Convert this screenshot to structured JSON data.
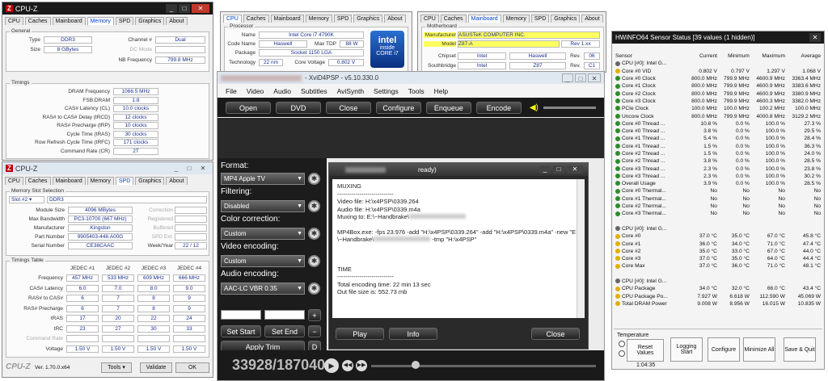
{
  "cpuz_mem": {
    "title": "CPU-Z",
    "tabs": [
      "CPU",
      "Caches",
      "Mainboard",
      "Memory",
      "SPD",
      "Graphics",
      "About"
    ],
    "active": "Memory",
    "general_label": "General",
    "type_label": "Type",
    "type": "DDR3",
    "size_label": "Size",
    "size": "8 GBytes",
    "channel_label": "Channel #",
    "channel": "Dual",
    "dcmode_label": "DC Mode",
    "nbfreq_label": "NB Frequency",
    "nbfreq": "799.8 MHz",
    "timings_label": "Timings",
    "timings": [
      {
        "l": "DRAM Frequency",
        "v": "1066.5 MHz"
      },
      {
        "l": "FSB:DRAM",
        "v": "1:8"
      },
      {
        "l": "CAS# Latency (CL)",
        "v": "10.0 clocks"
      },
      {
        "l": "RAS# to CAS# Delay (tRCD)",
        "v": "12 clocks"
      },
      {
        "l": "RAS# Precharge (tRP)",
        "v": "10 clocks"
      },
      {
        "l": "Cycle Time (tRAS)",
        "v": "30 clocks"
      },
      {
        "l": "Row Refresh Cycle Time (tRFC)",
        "v": "171 clocks"
      },
      {
        "l": "Command Rate (CR)",
        "v": "2T"
      }
    ]
  },
  "cpuz_spd": {
    "title": "CPU-Z",
    "tabs": [
      "CPU",
      "Caches",
      "Mainboard",
      "Memory",
      "SPD",
      "Graphics",
      "About"
    ],
    "active": "SPD",
    "slot_label": "Memory Slot Selection",
    "slot": "Slot #2",
    "slot_type": "DDR3",
    "rows": [
      {
        "l": "Module Size",
        "v": "4096 MBytes",
        "r": "Correction"
      },
      {
        "l": "Max Bandwidth",
        "v": "PC3-10700 (667 MHz)",
        "r": "Registered"
      },
      {
        "l": "Manufacturer",
        "v": "Kingston",
        "r": "Buffered"
      },
      {
        "l": "Part Number",
        "v": "9905403-448.A00G",
        "r": "SPD Ext."
      },
      {
        "l": "Serial Number",
        "v": "CE38CAAC",
        "r": "Week/Year",
        "rv": "22 / 12"
      }
    ],
    "tt_label": "Timings Table",
    "tt_headers": [
      "JEDEC #1",
      "JEDEC #2",
      "JEDEC #3",
      "JEDEC #4"
    ],
    "tt_rows": [
      {
        "l": "Frequency",
        "v": [
          "457 MHz",
          "533 MHz",
          "609 MHz",
          "666 MHz"
        ]
      },
      {
        "l": "CAS# Latency",
        "v": [
          "6.0",
          "7.0",
          "8.0",
          "9.0"
        ]
      },
      {
        "l": "RAS# to CAS#",
        "v": [
          "6",
          "7",
          "8",
          "9"
        ]
      },
      {
        "l": "RAS# Precharge",
        "v": [
          "6",
          "7",
          "8",
          "9"
        ]
      },
      {
        "l": "tRAS",
        "v": [
          "17",
          "20",
          "22",
          "24"
        ]
      },
      {
        "l": "tRC",
        "v": [
          "23",
          "27",
          "30",
          "33"
        ]
      },
      {
        "l": "Command Rate",
        "v": [
          "",
          "",
          "",
          ""
        ]
      },
      {
        "l": "Voltage",
        "v": [
          "1.50 V",
          "1.50 V",
          "1.50 V",
          "1.50 V"
        ]
      }
    ],
    "footer_brand": "CPU-Z",
    "version": "Ver. 1.70.0.x64",
    "tools": "Tools",
    "validate": "Validate",
    "ok": "OK"
  },
  "cpuz_cpu": {
    "tabs": [
      "CPU",
      "Caches",
      "Mainboard",
      "Memory",
      "SPD",
      "Graphics",
      "About"
    ],
    "active": "CPU",
    "processor_label": "Processor",
    "name_label": "Name",
    "name": "Intel Core i7 4790K",
    "codename_label": "Code Name",
    "codename": "Haswell",
    "maxtdp_label": "Max TDP",
    "maxtdp": "88 W",
    "package_label": "Package",
    "package": "Socket 1150 LGA",
    "tech_label": "Technology",
    "tech": "22 nm",
    "cv_label": "Core Voltage",
    "cv": "0.802 V",
    "badge1": "intel",
    "badge2": "inside",
    "badge3": "CORE i7"
  },
  "cpuz_mb": {
    "tabs": [
      "CPU",
      "Caches",
      "Mainboard",
      "Memory",
      "SPD",
      "Graphics",
      "About"
    ],
    "active": "Mainboard",
    "mb_label": "Motherboard",
    "manu_label": "Manufacturer",
    "manu": "ASUSTeK COMPUTER INC.",
    "model_label": "Model",
    "model": "Z87-A",
    "rev": "Rev 1.xx",
    "chipset_label": "Chipset",
    "chipset": "Intel",
    "chipset2": "Haswell",
    "rev_label": "Rev.",
    "rev1": "06",
    "sb_label": "Southbridge",
    "sb": "Intel",
    "sb2": "Z87",
    "rev2": "C1"
  },
  "xvid": {
    "title": "- XviD4PSP - v5.10.330.0",
    "menu": [
      "File",
      "Video",
      "Audio",
      "Subtitles",
      "AviSynth",
      "Settings",
      "Tools",
      "Help"
    ],
    "buttons": [
      "Open",
      "DVD",
      "Close",
      "Configure",
      "Enqueue",
      "Encode"
    ],
    "format_label": "Format:",
    "format": "MP4 Apple TV",
    "filtering_label": "Filtering:",
    "filtering": "Disabled",
    "cc_label": "Color correction:",
    "cc": "Custom",
    "venc_label": "Video encoding:",
    "venc": "Custom",
    "aenc_label": "Audio encoding:",
    "aenc": "AAC-LC VBR 0.35",
    "set_start": "Set Start",
    "set_end": "Set End",
    "apply_trim": "Apply Trim",
    "d": "D",
    "frame": "33928/187040",
    "dlg_title": "ready)",
    "muxing": "MUXING",
    "sep": "----------------------------",
    "vfile": "Video file: H:\\x4PSP\\0339.264",
    "afile": "Audio file: H:\\x4PSP\\0339.m4a",
    "muxto": "Muxing to: E:\\~Handbrake\\",
    "mp4box": "MP4Box.exe: -fps 23.976 -add \"H:\\x4PSP\\0339.264\" -add \"H:\\x4PSP\\0339.m4a\" -new \"E:",
    "mp4box2": "\\~Handbrake\\",
    "mp4box3": "-tmp \"H:\\x4PSP\"",
    "time": "TIME",
    "total": "Total encoding time: 22 min 13 sec",
    "outsize": "Out file size is: 552.73 mb",
    "play": "Play",
    "info": "Info",
    "close": "Close"
  },
  "hw": {
    "title": "HWiNFO64 Sensor Status [39 values (1 hidden)]",
    "headers": [
      "Sensor",
      "Current",
      "Minimum",
      "Maximum",
      "Average"
    ],
    "rows": [
      {
        "n": "CPU [#0]: Intel G...",
        "i": "c",
        "v": [
          "",
          "",
          "",
          ""
        ]
      },
      {
        "n": "Core #0 VID",
        "i": "y",
        "v": [
          "0.802 V",
          "0.797 V",
          "1.297 V",
          "1.068 V"
        ]
      },
      {
        "n": "Core #0 Clock",
        "i": "g",
        "v": [
          "800.0 MHz",
          "799.9 MHz",
          "4600.9 MHz",
          "3363.4 MHz"
        ]
      },
      {
        "n": "Core #1 Clock",
        "i": "g",
        "v": [
          "800.0 MHz",
          "799.9 MHz",
          "4600.9 MHz",
          "3383.6 MHz"
        ]
      },
      {
        "n": "Core #2 Clock",
        "i": "g",
        "v": [
          "800.0 MHz",
          "799.9 MHz",
          "4600.9 MHz",
          "3380.9 MHz"
        ]
      },
      {
        "n": "Core #3 Clock",
        "i": "g",
        "v": [
          "800.0 MHz",
          "799.9 MHz",
          "4600.3 MHz",
          "3382.0 MHz"
        ]
      },
      {
        "n": "PCIe Clock",
        "i": "g",
        "v": [
          "100.0 MHz",
          "100.0 MHz",
          "100.2 MHz",
          "100.0 MHz"
        ]
      },
      {
        "n": "Uncore Clock",
        "i": "g",
        "v": [
          "800.0 MHz",
          "799.9 MHz",
          "4000.8 MHz",
          "3129.2 MHz"
        ]
      },
      {
        "n": "Core #0 Thread ...",
        "i": "g",
        "v": [
          "10.8 %",
          "0.0 %",
          "100.0 %",
          "27.3 %"
        ]
      },
      {
        "n": "Core #0 Thread ...",
        "i": "g",
        "v": [
          "3.8 %",
          "0.0 %",
          "100.0 %",
          "29.5 %"
        ]
      },
      {
        "n": "Core #1 Thread ...",
        "i": "g",
        "v": [
          "5.4 %",
          "0.0 %",
          "100.0 %",
          "28.4 %"
        ]
      },
      {
        "n": "Core #1 Thread ...",
        "i": "g",
        "v": [
          "1.5 %",
          "0.0 %",
          "100.0 %",
          "36.3 %"
        ]
      },
      {
        "n": "Core #2 Thread ...",
        "i": "g",
        "v": [
          "1.5 %",
          "0.0 %",
          "100.0 %",
          "24.0 %"
        ]
      },
      {
        "n": "Core #2 Thread ...",
        "i": "g",
        "v": [
          "3.8 %",
          "0.0 %",
          "100.0 %",
          "28.5 %"
        ]
      },
      {
        "n": "Core #3 Thread ...",
        "i": "g",
        "v": [
          "2.3 %",
          "0.0 %",
          "100.0 %",
          "23.8 %"
        ]
      },
      {
        "n": "Core #3 Thread ...",
        "i": "g",
        "v": [
          "2.3 %",
          "0.0 %",
          "100.0 %",
          "30.2 %"
        ]
      },
      {
        "n": "Overall Usage",
        "i": "g",
        "v": [
          "3.9 %",
          "0.0 %",
          "100.0 %",
          "28.5 %"
        ]
      },
      {
        "n": "Core #0 Thermal...",
        "i": "g",
        "v": [
          "No",
          "No",
          "No",
          "No"
        ]
      },
      {
        "n": "Core #1 Thermal...",
        "i": "g",
        "v": [
          "No",
          "No",
          "No",
          "No"
        ]
      },
      {
        "n": "Core #2 Thermal...",
        "i": "g",
        "v": [
          "No",
          "No",
          "No",
          "No"
        ]
      },
      {
        "n": "Core #3 Thermal...",
        "i": "g",
        "v": [
          "No",
          "No",
          "No",
          "No"
        ]
      },
      {
        "n": "",
        "i": "",
        "v": [
          "",
          "",
          "",
          ""
        ]
      },
      {
        "n": "CPU [#0]: Intel G...",
        "i": "c",
        "v": [
          "",
          "",
          "",
          ""
        ]
      },
      {
        "n": "Core #0",
        "i": "y",
        "v": [
          "37.0 °C",
          "35.0 °C",
          "67.0 °C",
          "45.8 °C"
        ]
      },
      {
        "n": "Core #1",
        "i": "y",
        "v": [
          "36.0 °C",
          "34.0 °C",
          "71.0 °C",
          "47.4 °C"
        ]
      },
      {
        "n": "Core #2",
        "i": "y",
        "v": [
          "35.0 °C",
          "33.0 °C",
          "67.0 °C",
          "44.0 °C"
        ]
      },
      {
        "n": "Core #3",
        "i": "y",
        "v": [
          "37.0 °C",
          "35.0 °C",
          "64.0 °C",
          "44.4 °C"
        ]
      },
      {
        "n": "Core Max",
        "i": "y",
        "v": [
          "37.0 °C",
          "36.0 °C",
          "71.0 °C",
          "48.1 °C"
        ]
      },
      {
        "n": "",
        "i": "",
        "v": [
          "",
          "",
          "",
          ""
        ]
      },
      {
        "n": "CPU [#0]: Intel G...",
        "i": "c",
        "v": [
          "",
          "",
          "",
          ""
        ]
      },
      {
        "n": "CPU Package",
        "i": "y",
        "v": [
          "34.0 °C",
          "32.0 °C",
          "66.0 °C",
          "43.4 °C"
        ]
      },
      {
        "n": "CPU Package Po...",
        "i": "y",
        "v": [
          "7.927 W",
          "6.618 W",
          "112.590 W",
          "45.069 W"
        ]
      },
      {
        "n": "Total DRAM Power",
        "i": "y",
        "v": [
          "9.008 W",
          "8.956 W",
          "16.015 W",
          "10.835 W"
        ]
      }
    ],
    "temp_label": "Temperature",
    "reset": "Reset",
    "values": "Values",
    "logging": "Logging Start",
    "configure": "Configure",
    "minimize": "Minimize All",
    "save": "Save & Quit",
    "elapsed": "1:04:35"
  }
}
